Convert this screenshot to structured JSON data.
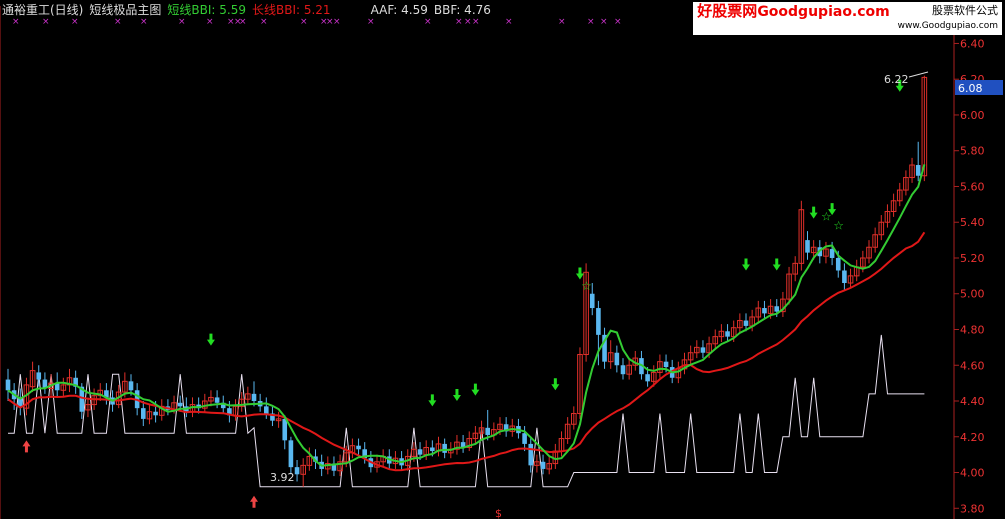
{
  "header": {
    "stock": "通裕重工(日线)",
    "indicator": "短线极品主图",
    "short_bbi_label": "短线BBI: 5.59",
    "long_bbi_label": "长线BBI: 5.21",
    "aaf_label": "AAF: 4.59",
    "bbf_label": "BBF: 4.76"
  },
  "watermark": {
    "brand": "好股票网",
    "site": "Goodgupiao.com",
    "line1": "股票软件公式",
    "line2": "www.Goodgupiao.com"
  },
  "colors": {
    "background": "#000000",
    "up_candle": "#e0302a",
    "down_candle": "#5ab8f0",
    "short_bbi": "#33cc33",
    "long_bbi": "#e01818",
    "indicator_line": "#e8e0f0",
    "marker_x": "#cc33cc",
    "arrow_down": "#22dd22",
    "arrow_up": "#ee4444",
    "axis": "#aa2020",
    "price_label_bg": "#2050c0"
  },
  "chart_data": {
    "type": "candlestick",
    "y_axis": {
      "ticks": [
        6.4,
        6.2,
        6.0,
        5.8,
        5.6,
        5.4,
        5.2,
        5.0,
        4.8,
        4.6,
        4.4,
        4.2,
        4.0,
        3.8
      ],
      "ylim": [
        3.74,
        6.52
      ],
      "current_price": "6.08"
    },
    "annotations": {
      "high_label": "6.22",
      "low_label": "3.92",
      "bottom_marker": "$"
    },
    "series": [
      {
        "name": "短线BBI",
        "last_value": 5.59
      },
      {
        "name": "长线BBI",
        "last_value": 5.21
      }
    ],
    "aaf": 4.59,
    "bbf": 4.76,
    "candles": [
      [
        4.52,
        4.46,
        4.58,
        4.4
      ],
      [
        4.46,
        4.41,
        4.5,
        4.35
      ],
      [
        4.42,
        4.37,
        4.47,
        4.32
      ],
      [
        4.36,
        4.49,
        4.53,
        4.32
      ],
      [
        4.48,
        4.57,
        4.62,
        4.45
      ],
      [
        4.56,
        4.52,
        4.6,
        4.48
      ],
      [
        4.52,
        4.47,
        4.56,
        4.44
      ],
      [
        4.47,
        4.5,
        4.55,
        4.43
      ],
      [
        4.5,
        4.46,
        4.56,
        4.42
      ],
      [
        4.46,
        4.49,
        4.53,
        4.42
      ],
      [
        4.49,
        4.53,
        4.58,
        4.45
      ],
      [
        4.53,
        4.48,
        4.57,
        4.44
      ],
      [
        4.48,
        4.34,
        4.5,
        4.3
      ],
      [
        4.35,
        4.38,
        4.42,
        4.31
      ],
      [
        4.38,
        4.43,
        4.47,
        4.35
      ],
      [
        4.43,
        4.46,
        4.5,
        4.4
      ],
      [
        4.46,
        4.42,
        4.5,
        4.38
      ],
      [
        4.42,
        4.38,
        4.46,
        4.34
      ],
      [
        4.38,
        4.45,
        4.49,
        4.36
      ],
      [
        4.45,
        4.51,
        4.56,
        4.42
      ],
      [
        4.51,
        4.46,
        4.55,
        4.43
      ],
      [
        4.46,
        4.36,
        4.5,
        4.32
      ],
      [
        4.36,
        4.3,
        4.4,
        4.26
      ],
      [
        4.3,
        4.34,
        4.38,
        4.27
      ],
      [
        4.34,
        4.32,
        4.4,
        4.28
      ],
      [
        4.32,
        4.37,
        4.41,
        4.29
      ],
      [
        4.37,
        4.35,
        4.41,
        4.32
      ],
      [
        4.35,
        4.39,
        4.43,
        4.33
      ],
      [
        4.39,
        4.37,
        4.43,
        4.34
      ],
      [
        4.37,
        4.34,
        4.42,
        4.31
      ],
      [
        4.34,
        4.38,
        4.42,
        4.31
      ],
      [
        4.38,
        4.36,
        4.42,
        4.33
      ],
      [
        4.36,
        4.4,
        4.44,
        4.34
      ],
      [
        4.4,
        4.42,
        4.46,
        4.37
      ],
      [
        4.42,
        4.39,
        4.46,
        4.36
      ],
      [
        4.39,
        4.36,
        4.43,
        4.33
      ],
      [
        4.36,
        4.32,
        4.4,
        4.28
      ],
      [
        4.32,
        4.37,
        4.41,
        4.29
      ],
      [
        4.37,
        4.41,
        4.45,
        4.34
      ],
      [
        4.41,
        4.44,
        4.48,
        4.38
      ],
      [
        4.44,
        4.4,
        4.51,
        4.37
      ],
      [
        4.4,
        4.37,
        4.44,
        4.34
      ],
      [
        4.37,
        4.33,
        4.42,
        4.3
      ],
      [
        4.33,
        4.29,
        4.37,
        4.26
      ],
      [
        4.29,
        4.3,
        4.34,
        4.25
      ],
      [
        4.3,
        4.18,
        4.32,
        4.13
      ],
      [
        4.18,
        4.03,
        4.2,
        3.99
      ],
      [
        4.03,
        3.99,
        4.07,
        3.95
      ],
      [
        3.99,
        4.04,
        4.08,
        3.92
      ],
      [
        4.04,
        4.09,
        4.14,
        4.01
      ],
      [
        4.09,
        4.06,
        4.13,
        4.02
      ],
      [
        4.06,
        4.02,
        4.1,
        3.98
      ],
      [
        4.02,
        4.05,
        4.09,
        3.99
      ],
      [
        4.05,
        4.01,
        4.09,
        3.98
      ],
      [
        4.01,
        4.06,
        4.1,
        3.98
      ],
      [
        4.06,
        4.11,
        4.15,
        4.03
      ],
      [
        4.11,
        4.15,
        4.19,
        4.08
      ],
      [
        4.15,
        4.13,
        4.19,
        4.1
      ],
      [
        4.13,
        4.08,
        4.17,
        4.05
      ],
      [
        4.08,
        4.03,
        4.12,
        4.0
      ],
      [
        4.03,
        4.06,
        4.1,
        4.0
      ],
      [
        4.06,
        4.09,
        4.13,
        4.03
      ],
      [
        4.09,
        4.05,
        4.13,
        4.02
      ],
      [
        4.05,
        4.08,
        4.12,
        4.02
      ],
      [
        4.08,
        4.04,
        4.12,
        4.01
      ],
      [
        4.04,
        4.09,
        4.13,
        4.01
      ],
      [
        4.09,
        4.13,
        4.17,
        4.06
      ],
      [
        4.13,
        4.1,
        4.17,
        4.07
      ],
      [
        4.1,
        4.14,
        4.18,
        4.07
      ],
      [
        4.14,
        4.12,
        4.18,
        4.09
      ],
      [
        4.12,
        4.16,
        4.2,
        4.09
      ],
      [
        4.16,
        4.11,
        4.19,
        4.08
      ],
      [
        4.11,
        4.13,
        4.17,
        4.08
      ],
      [
        4.13,
        4.17,
        4.21,
        4.1
      ],
      [
        4.17,
        4.14,
        4.21,
        4.11
      ],
      [
        4.14,
        4.19,
        4.23,
        4.12
      ],
      [
        4.19,
        4.22,
        4.26,
        4.16
      ],
      [
        4.22,
        4.25,
        4.29,
        4.19
      ],
      [
        4.25,
        4.21,
        4.35,
        4.18
      ],
      [
        4.21,
        4.24,
        4.28,
        4.18
      ],
      [
        4.24,
        4.27,
        4.31,
        4.21
      ],
      [
        4.27,
        4.23,
        4.31,
        4.2
      ],
      [
        4.23,
        4.26,
        4.3,
        4.2
      ],
      [
        4.26,
        4.22,
        4.3,
        4.19
      ],
      [
        4.22,
        4.16,
        4.26,
        4.12
      ],
      [
        4.16,
        4.04,
        4.2,
        4.0
      ],
      [
        4.04,
        4.06,
        4.1,
        4.0
      ],
      [
        4.06,
        4.02,
        4.1,
        3.99
      ],
      [
        4.02,
        4.05,
        4.09,
        3.99
      ],
      [
        4.05,
        4.12,
        4.16,
        4.02
      ],
      [
        4.12,
        4.19,
        4.23,
        4.09
      ],
      [
        4.19,
        4.27,
        4.31,
        4.16
      ],
      [
        4.27,
        4.33,
        4.37,
        4.24
      ],
      [
        4.33,
        4.66,
        4.7,
        4.3
      ],
      [
        4.66,
        5.12,
        5.17,
        4.62
      ],
      [
        5.0,
        4.92,
        5.06,
        4.88
      ],
      [
        4.92,
        4.77,
        4.96,
        4.6
      ],
      [
        4.77,
        4.62,
        4.81,
        4.58
      ],
      [
        4.62,
        4.67,
        4.74,
        4.58
      ],
      [
        4.67,
        4.6,
        4.71,
        4.56
      ],
      [
        4.6,
        4.55,
        4.64,
        4.52
      ],
      [
        4.55,
        4.6,
        4.64,
        4.52
      ],
      [
        4.6,
        4.64,
        4.68,
        4.57
      ],
      [
        4.64,
        4.55,
        4.68,
        4.52
      ],
      [
        4.55,
        4.51,
        4.59,
        4.48
      ],
      [
        4.51,
        4.56,
        4.6,
        4.48
      ],
      [
        4.56,
        4.62,
        4.66,
        4.53
      ],
      [
        4.62,
        4.59,
        4.66,
        4.56
      ],
      [
        4.59,
        4.53,
        4.63,
        4.5
      ],
      [
        4.53,
        4.58,
        4.62,
        4.5
      ],
      [
        4.58,
        4.63,
        4.67,
        4.55
      ],
      [
        4.63,
        4.67,
        4.71,
        4.6
      ],
      [
        4.67,
        4.7,
        4.74,
        4.64
      ],
      [
        4.7,
        4.67,
        4.74,
        4.64
      ],
      [
        4.67,
        4.72,
        4.76,
        4.64
      ],
      [
        4.72,
        4.76,
        4.8,
        4.69
      ],
      [
        4.76,
        4.79,
        4.83,
        4.73
      ],
      [
        4.79,
        4.76,
        4.83,
        4.73
      ],
      [
        4.76,
        4.81,
        4.85,
        4.73
      ],
      [
        4.81,
        4.85,
        4.89,
        4.78
      ],
      [
        4.85,
        4.82,
        4.89,
        4.79
      ],
      [
        4.82,
        4.87,
        4.91,
        4.79
      ],
      [
        4.87,
        4.92,
        4.96,
        4.84
      ],
      [
        4.92,
        4.89,
        4.96,
        4.86
      ],
      [
        4.89,
        4.93,
        4.97,
        4.86
      ],
      [
        4.93,
        4.9,
        4.97,
        4.87
      ],
      [
        4.9,
        4.97,
        5.01,
        4.87
      ],
      [
        4.97,
        5.11,
        5.15,
        4.94
      ],
      [
        5.11,
        5.17,
        5.21,
        5.07
      ],
      [
        5.17,
        5.47,
        5.52,
        5.13
      ],
      [
        5.3,
        5.23,
        5.35,
        5.19
      ],
      [
        5.23,
        5.26,
        5.3,
        5.19
      ],
      [
        5.26,
        5.21,
        5.3,
        5.17
      ],
      [
        5.21,
        5.25,
        5.29,
        5.17
      ],
      [
        5.25,
        5.2,
        5.29,
        5.16
      ],
      [
        5.2,
        5.13,
        5.24,
        5.09
      ],
      [
        5.13,
        5.06,
        5.17,
        5.02
      ],
      [
        5.06,
        5.1,
        5.14,
        5.03
      ],
      [
        5.1,
        5.15,
        5.19,
        5.07
      ],
      [
        5.15,
        5.2,
        5.24,
        5.12
      ],
      [
        5.2,
        5.26,
        5.3,
        5.17
      ],
      [
        5.26,
        5.33,
        5.37,
        5.23
      ],
      [
        5.33,
        5.4,
        5.44,
        5.3
      ],
      [
        5.4,
        5.46,
        5.5,
        5.37
      ],
      [
        5.46,
        5.52,
        5.56,
        5.43
      ],
      [
        5.52,
        5.58,
        5.62,
        5.49
      ],
      [
        5.58,
        5.65,
        5.69,
        5.55
      ],
      [
        5.65,
        5.72,
        5.76,
        5.62
      ],
      [
        5.72,
        5.66,
        5.85,
        5.63
      ],
      [
        5.66,
        6.21,
        6.22,
        5.63
      ]
    ]
  }
}
